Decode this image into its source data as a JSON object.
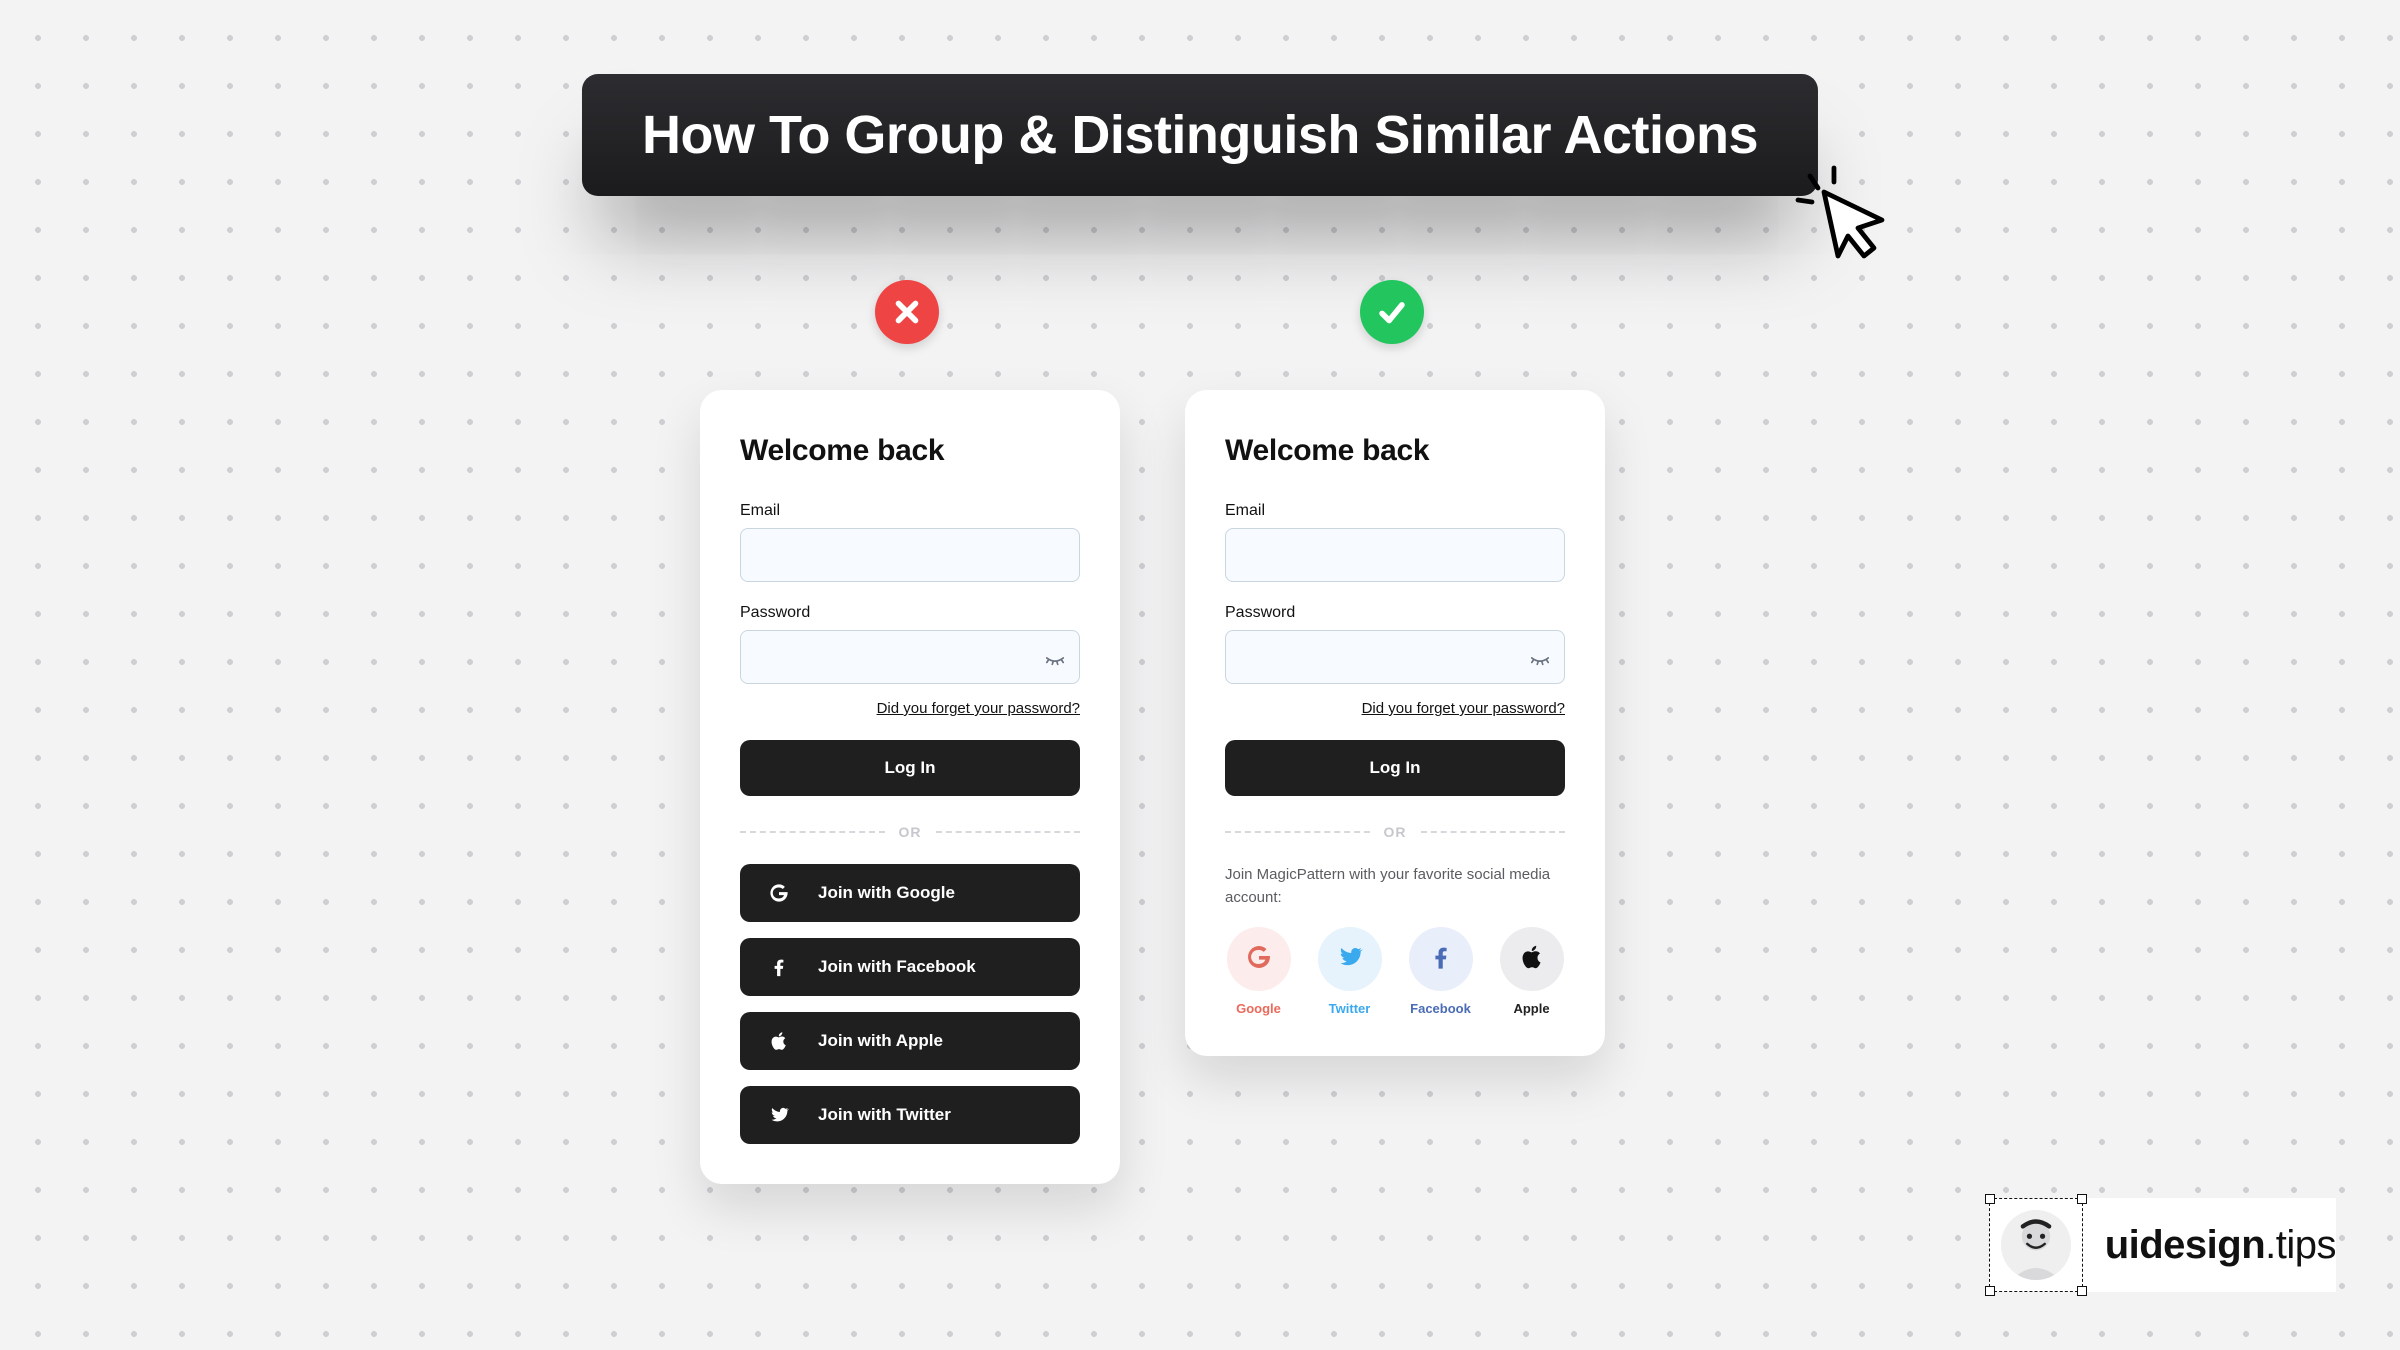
{
  "banner": {
    "title": "How To Group & Distinguish Similar Actions"
  },
  "bad": {
    "title": "Welcome back",
    "email_label": "Email",
    "password_label": "Password",
    "forgot_label": "Did you forget your password?",
    "login_label": "Log In",
    "divider_label": "OR",
    "social": {
      "google": "Join with Google",
      "facebook": "Join with Facebook",
      "apple": "Join with Apple",
      "twitter": "Join with Twitter"
    }
  },
  "good": {
    "title": "Welcome back",
    "email_label": "Email",
    "password_label": "Password",
    "forgot_label": "Did you forget your password?",
    "login_label": "Log In",
    "divider_label": "OR",
    "join_note": "Join MagicPattern with your favorite social media account:",
    "chips": {
      "google": "Google",
      "twitter": "Twitter",
      "facebook": "Facebook",
      "apple": "Apple"
    }
  },
  "footer": {
    "brand_bold": "uidesign",
    "brand_rest": ".tips"
  }
}
